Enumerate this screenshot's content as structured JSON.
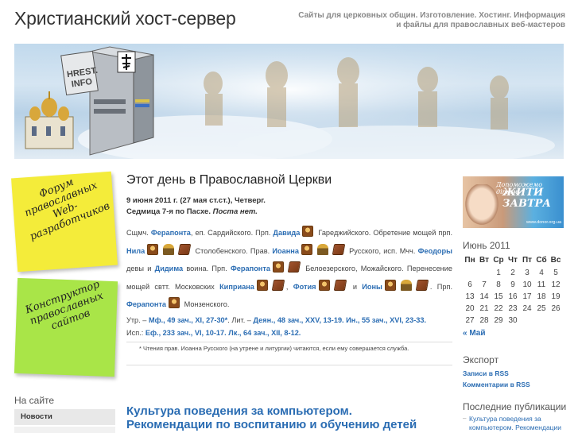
{
  "header": {
    "site_title": "Христианский хост-сервер",
    "site_description_line1": "Сайты для церковных общин. Изготовление. Хостинг. Информация",
    "site_description_line2": "и файлы для православных веб-мастеров",
    "logo_text": "HREST. INFO"
  },
  "left": {
    "sticky1_text": "Форум православных Web-разработчиков",
    "sticky2_text": "Конструктор православных сайтов",
    "section_title": "На сайте",
    "menu": [
      {
        "label": "Новости"
      },
      {
        "label": ""
      }
    ]
  },
  "post": {
    "title": "Этот день в Православной Церкви",
    "date_line": "9 июня 2011 г. (27 мая ст.ст.), Четверг.",
    "week_prefix": "Седмица 7-я по Пасхе.",
    "fast": "Поста нет.",
    "p1": "Сщмч.",
    "n_ferapont1": "Ферапонта",
    "p2": ", еп. Сардийского. Прп.",
    "n_david": "Давида",
    "p3": "Гареджийского. Обретение мощей прп.",
    "n_nil": "Нила",
    "p4": "Столобенского. Прав.",
    "n_ioann": "Иоанна",
    "p5": "Русского, исп. Мчч.",
    "n_feodora": "Феодоры",
    "p6": "девы и",
    "n_didim": "Дидима",
    "p7": "воина. Прп.",
    "n_ferapont2": "Ферапонта",
    "p8": "Белоезерского, Можайского. Перенесение мощей свтт. Московских",
    "n_kiprian": "Киприана",
    "p9": ",",
    "n_fotiy": "Фотия",
    "p10": "и",
    "n_iona": "Ионы",
    "p11": ". Прп.",
    "n_ferapont3": "Ферапонта",
    "p12": "Монзенского.",
    "utr_label": "Утр. –",
    "utr_reading": "Мф., 49 зач., XI, 27-30*",
    "lit_label": ". Лит. –",
    "lit_reading1": "Деян., 48 зач., XXV, 13-19.",
    "lit_reading2": "Ин., 55 зач., XVI, 23-33.",
    "isp_label": "Исп.:",
    "isp_reading1": "Еф., 233 зач., VI, 10-17.",
    "isp_reading2": "Лк., 64 зач., XII, 8-12.",
    "note": "* Чтения прав. Иоанна Русского (на утрене и литургии) читаются, если ему совершается служба."
  },
  "post2": {
    "title_line1": "Культура поведения за компьютером.",
    "title_line2": "Рекомендации по воспитанию и обучению детей"
  },
  "right": {
    "banner_line1": "Допоможемо дітям",
    "banner_line2": "ЖИТИ ЗАВТРА",
    "banner_url": "www.donor.org.ua",
    "calendar_title": "Июнь 2011",
    "weekdays": [
      "Пн",
      "Вт",
      "Ср",
      "Чт",
      "Пт",
      "Сб",
      "Вс"
    ],
    "weeks": [
      [
        "",
        "",
        "1",
        "2",
        "3",
        "4",
        "5"
      ],
      [
        "6",
        "7",
        "8",
        "9",
        "10",
        "11",
        "12"
      ],
      [
        "13",
        "14",
        "15",
        "16",
        "17",
        "18",
        "19"
      ],
      [
        "20",
        "21",
        "22",
        "23",
        "24",
        "25",
        "26"
      ],
      [
        "27",
        "28",
        "29",
        "30",
        "",
        "",
        ""
      ]
    ],
    "prev_month": "« Май",
    "export_title": "Экспорт",
    "export_links": [
      "Записи в RSS",
      "Комментарии в RSS"
    ],
    "recent_title": "Последние публикации",
    "recent_item": "Культура поведения за компьютером. Рекомендации по"
  },
  "colors": {
    "link": "#2b6db3",
    "sticky_yellow": "#f4ec3a",
    "sticky_green": "#a9e548"
  }
}
